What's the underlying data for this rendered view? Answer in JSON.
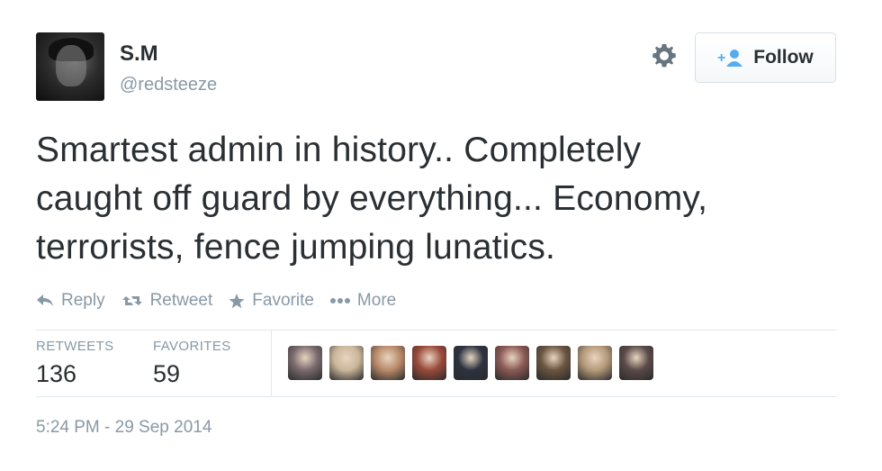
{
  "user": {
    "name": "S.M",
    "handle": "@redsteeze"
  },
  "follow_button": {
    "label": "Follow"
  },
  "tweet": {
    "lines": [
      "Smartest admin in history.. Completely",
      "caught off guard by everything... Economy,",
      "terrorists, fence jumping lunatics."
    ]
  },
  "actions": {
    "reply": "Reply",
    "retweet": "Retweet",
    "favorite": "Favorite",
    "more": "More"
  },
  "stats": {
    "retweets_label": "RETWEETS",
    "retweets_value": "136",
    "favorites_label": "FAVORITES",
    "favorites_value": "59"
  },
  "favoriter_avatars": [
    {
      "icon": "user-avatar",
      "color": "#7a6a6e"
    },
    {
      "icon": "user-avatar",
      "color": "#c9b69a"
    },
    {
      "icon": "flags-avatar",
      "color": "#b88a6a"
    },
    {
      "icon": "user-avatar",
      "color": "#9a4a3a"
    },
    {
      "icon": "user-avatar",
      "color": "#2c3340"
    },
    {
      "icon": "user-avatar",
      "color": "#8a5a55"
    },
    {
      "icon": "user-avatar",
      "color": "#6a5540"
    },
    {
      "icon": "user-avatar",
      "color": "#b59a7a"
    },
    {
      "icon": "user-avatar",
      "color": "#5a4a48"
    }
  ],
  "timestamp": "5:24 PM - 29 Sep 2014",
  "colors": {
    "text": "#292f33",
    "muted": "#8899a6",
    "follow_icon": "#55acee",
    "divider": "#e1e8ed"
  }
}
